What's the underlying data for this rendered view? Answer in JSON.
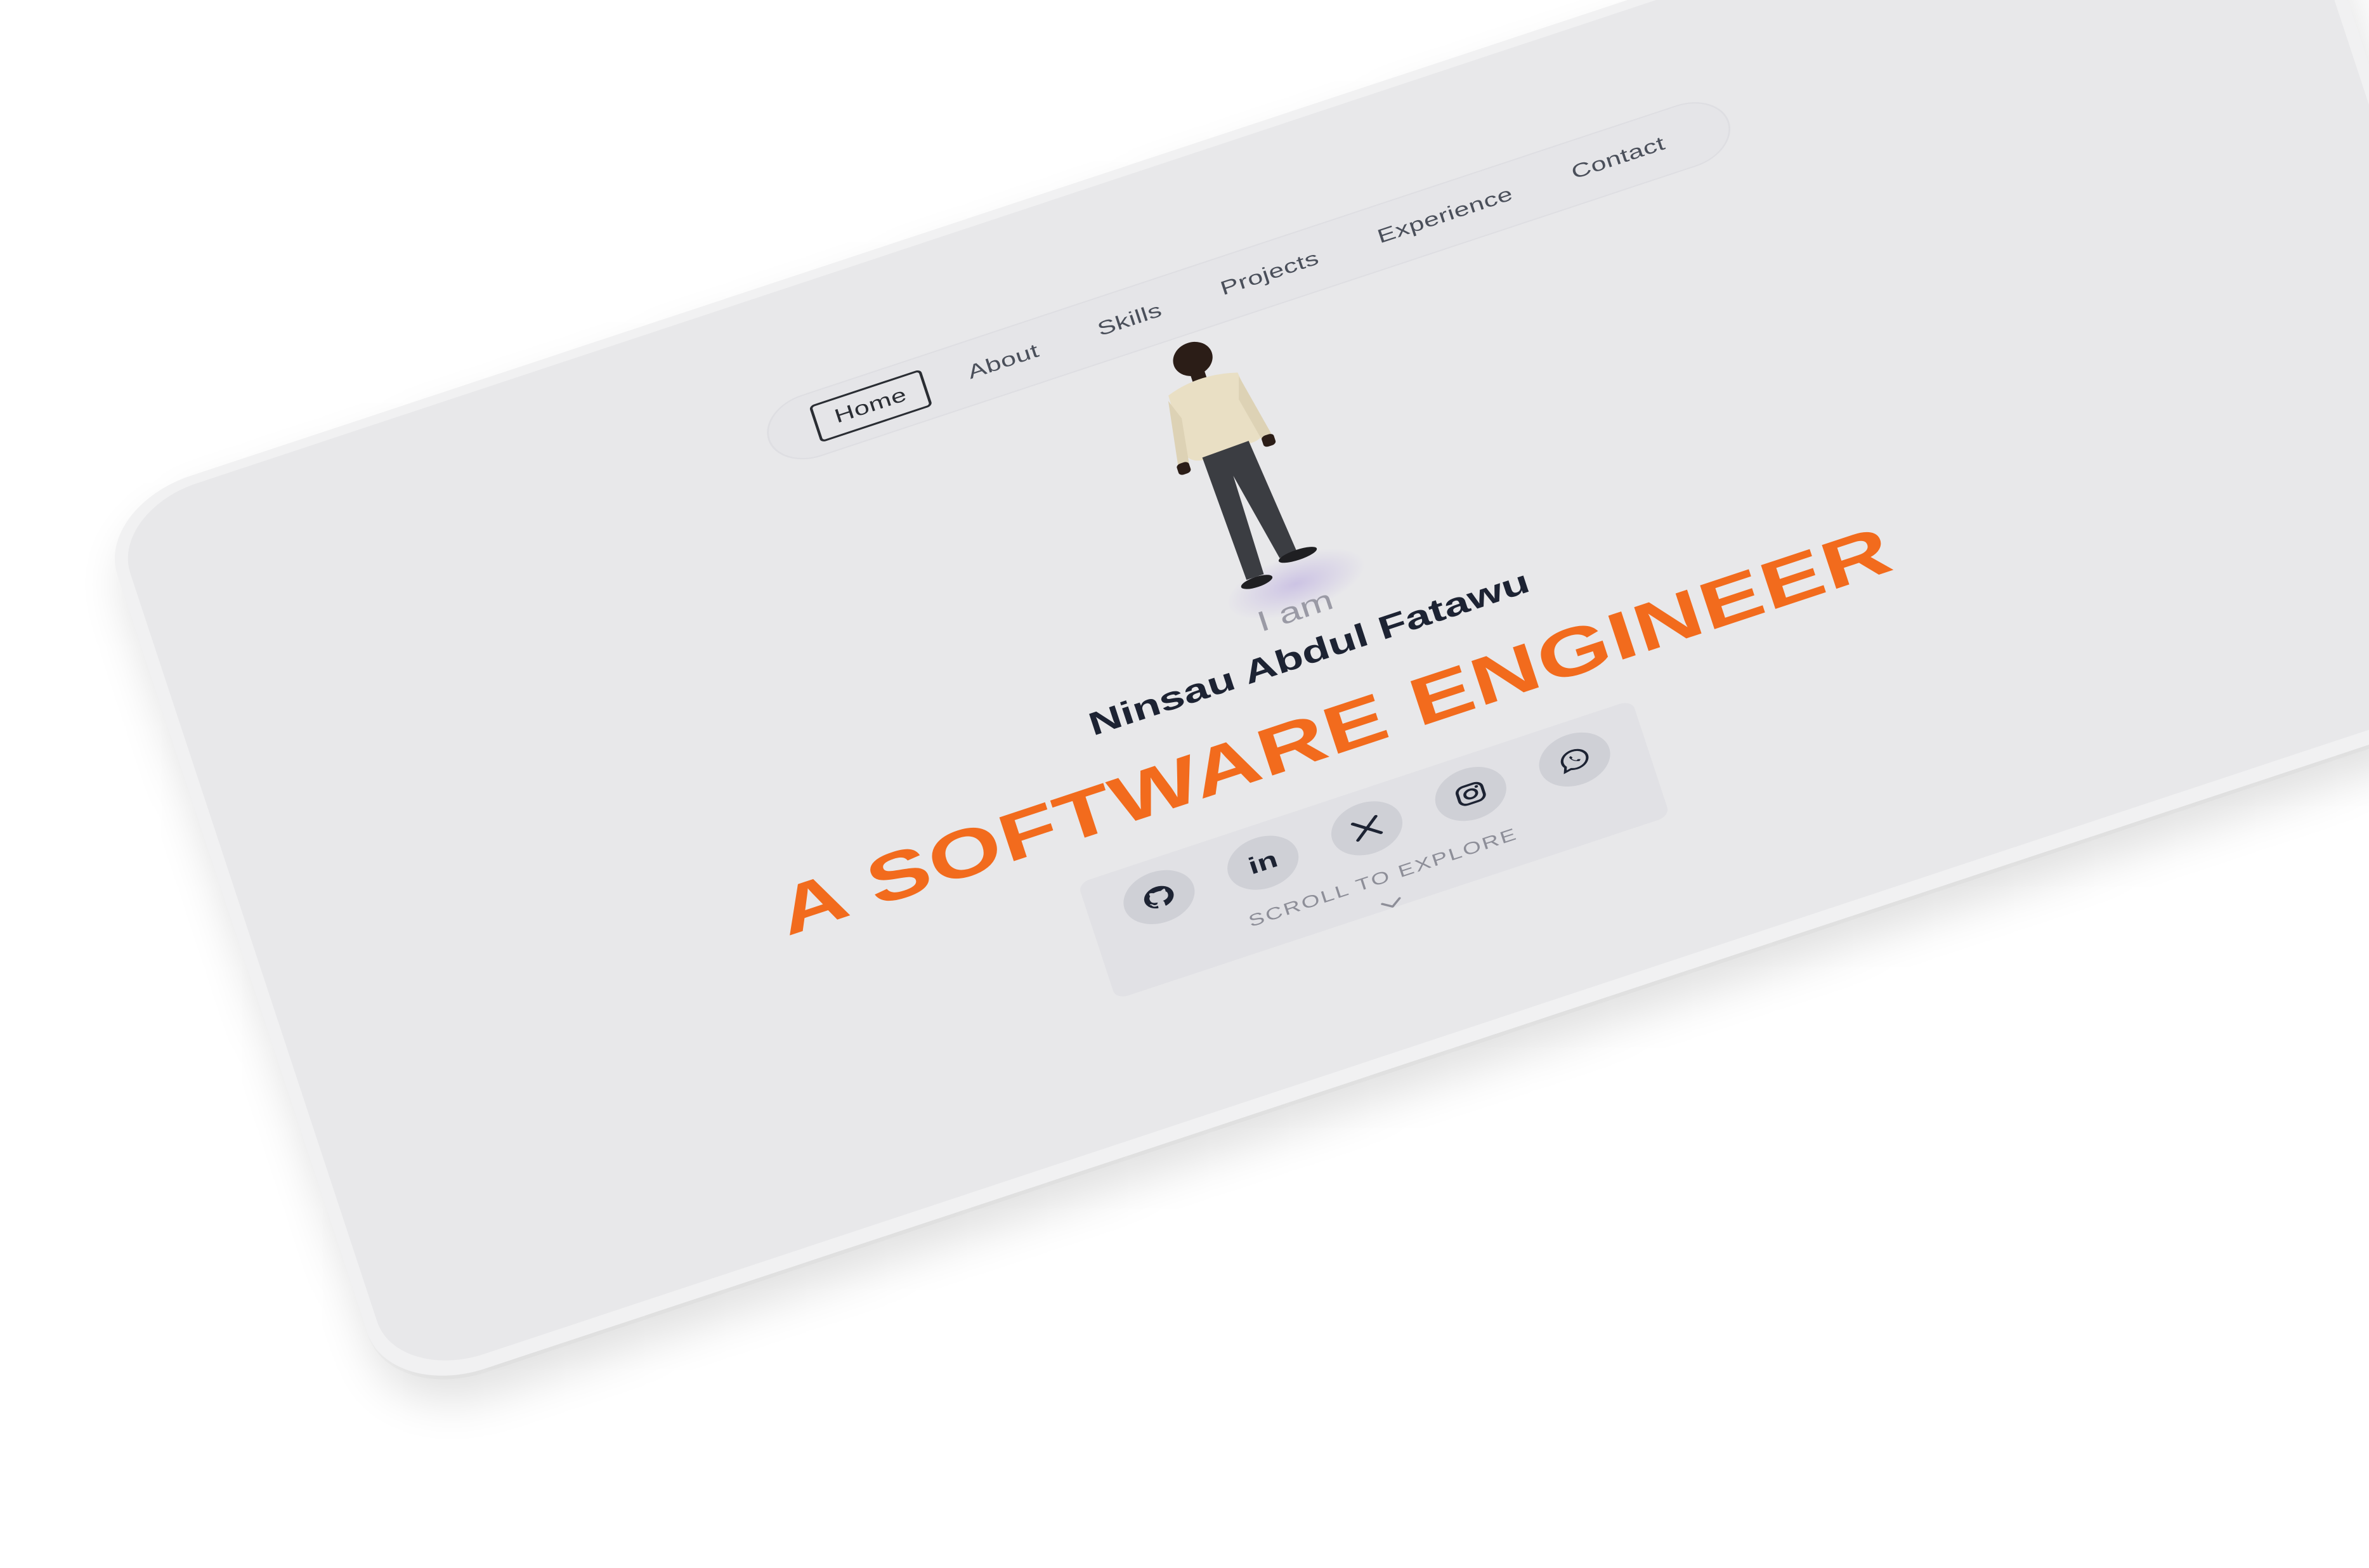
{
  "nav": {
    "items": [
      {
        "label": "Home",
        "active": true
      },
      {
        "label": "About"
      },
      {
        "label": "Skills"
      },
      {
        "label": "Projects"
      },
      {
        "label": "Experience"
      },
      {
        "label": "Contact"
      }
    ]
  },
  "hero": {
    "intro": "I am",
    "name": "Ninsau Abdul Fatawu",
    "role": "A SOFTWARE ENGINEER"
  },
  "social": {
    "icons": [
      "github-icon",
      "linkedin-icon",
      "x-icon",
      "instagram-icon",
      "whatsapp-icon"
    ],
    "linkedin_text": "in"
  },
  "scroll": {
    "label": "SCROLL TO EXPLORE"
  },
  "colors": {
    "accent": "#f26b1d",
    "background": "#e8e8ea",
    "text_dark": "#1d2333",
    "muted": "#9a9aa5"
  }
}
